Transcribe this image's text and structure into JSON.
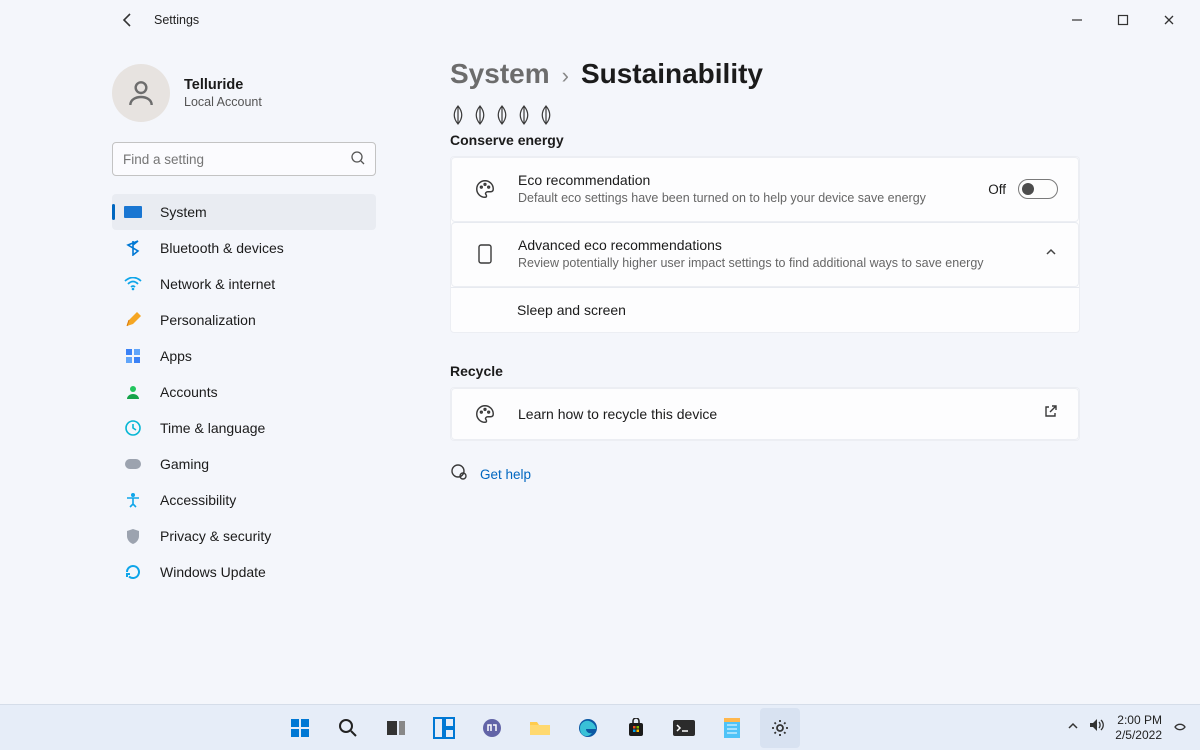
{
  "titlebar": {
    "title": "Settings"
  },
  "account": {
    "name": "Telluride",
    "sub": "Local Account"
  },
  "search": {
    "placeholder": "Find a setting"
  },
  "nav": {
    "items": [
      {
        "label": "System"
      },
      {
        "label": "Bluetooth & devices"
      },
      {
        "label": "Network & internet"
      },
      {
        "label": "Personalization"
      },
      {
        "label": "Apps"
      },
      {
        "label": "Accounts"
      },
      {
        "label": "Time & language"
      },
      {
        "label": "Gaming"
      },
      {
        "label": "Accessibility"
      },
      {
        "label": "Privacy & security"
      },
      {
        "label": "Windows Update"
      }
    ]
  },
  "crumbs": {
    "parent": "System",
    "here": "Sustainability"
  },
  "sections": {
    "conserve": {
      "heading": "Conserve energy"
    },
    "recycle": {
      "heading": "Recycle"
    }
  },
  "eco": {
    "title": "Eco recommendation",
    "sub": "Default eco settings have been turned on to help your device save energy",
    "state_label": "Off"
  },
  "adv": {
    "title": "Advanced eco recommendations",
    "sub": "Review potentially higher user impact settings to find additional ways to save energy"
  },
  "sleep": {
    "title": "Sleep and screen"
  },
  "recycle_row": {
    "title": "Learn how to recycle this device"
  },
  "help": {
    "label": "Get help"
  },
  "clock": {
    "time": "2:00 PM",
    "date": "2/5/2022"
  }
}
